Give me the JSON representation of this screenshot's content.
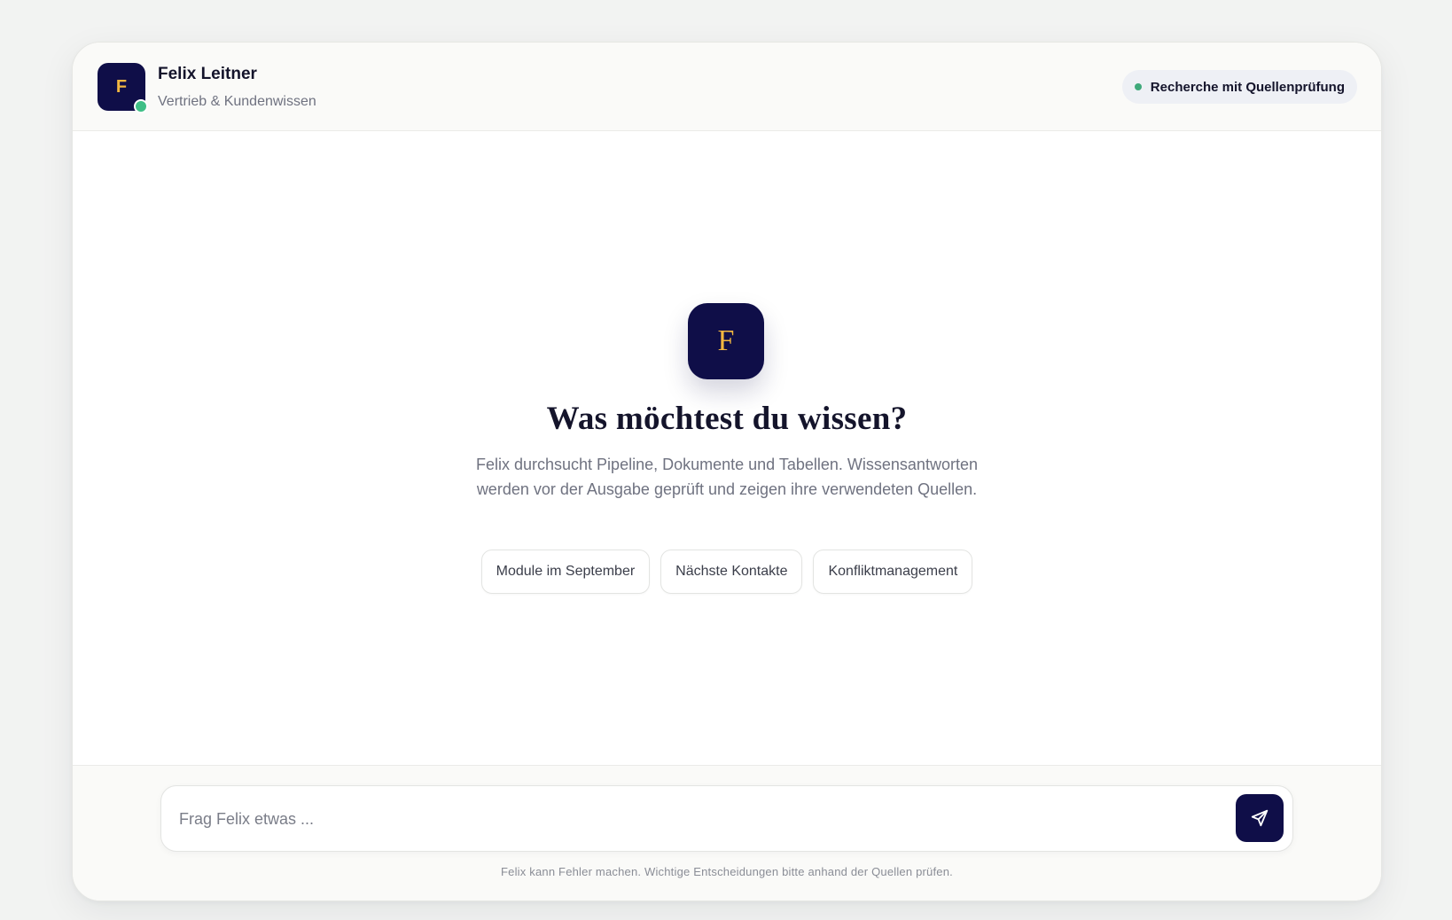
{
  "header": {
    "avatar_letter": "F",
    "name": "Felix Leitner",
    "role": "Vertrieb & Kundenwissen",
    "status_badge": "Recherche mit Quellenprüfung"
  },
  "hero": {
    "logo_letter": "F",
    "title": "Was möchtest du wissen?",
    "description": "Felix durchsucht Pipeline, Dokumente und Tabellen. Wissensantworten werden vor der Ausgabe geprüft und zeigen ihre verwendeten Quellen.",
    "suggestions": [
      {
        "label": "Module im September"
      },
      {
        "label": "Nächste Kontakte"
      },
      {
        "label": "Konfliktmanagement"
      }
    ]
  },
  "composer": {
    "placeholder": "Frag Felix etwas ...",
    "value": "",
    "send_icon": "paper-plane-icon"
  },
  "footer": {
    "disclaimer": "Felix kann Fehler machen. Wichtige Entscheidungen bitte anhand der Quellen prüfen."
  },
  "colors": {
    "brand_navy": "#0f0e48",
    "brand_gold": "#f2b740",
    "online_green": "#3fbf86",
    "badge_background": "#eef0f5"
  }
}
